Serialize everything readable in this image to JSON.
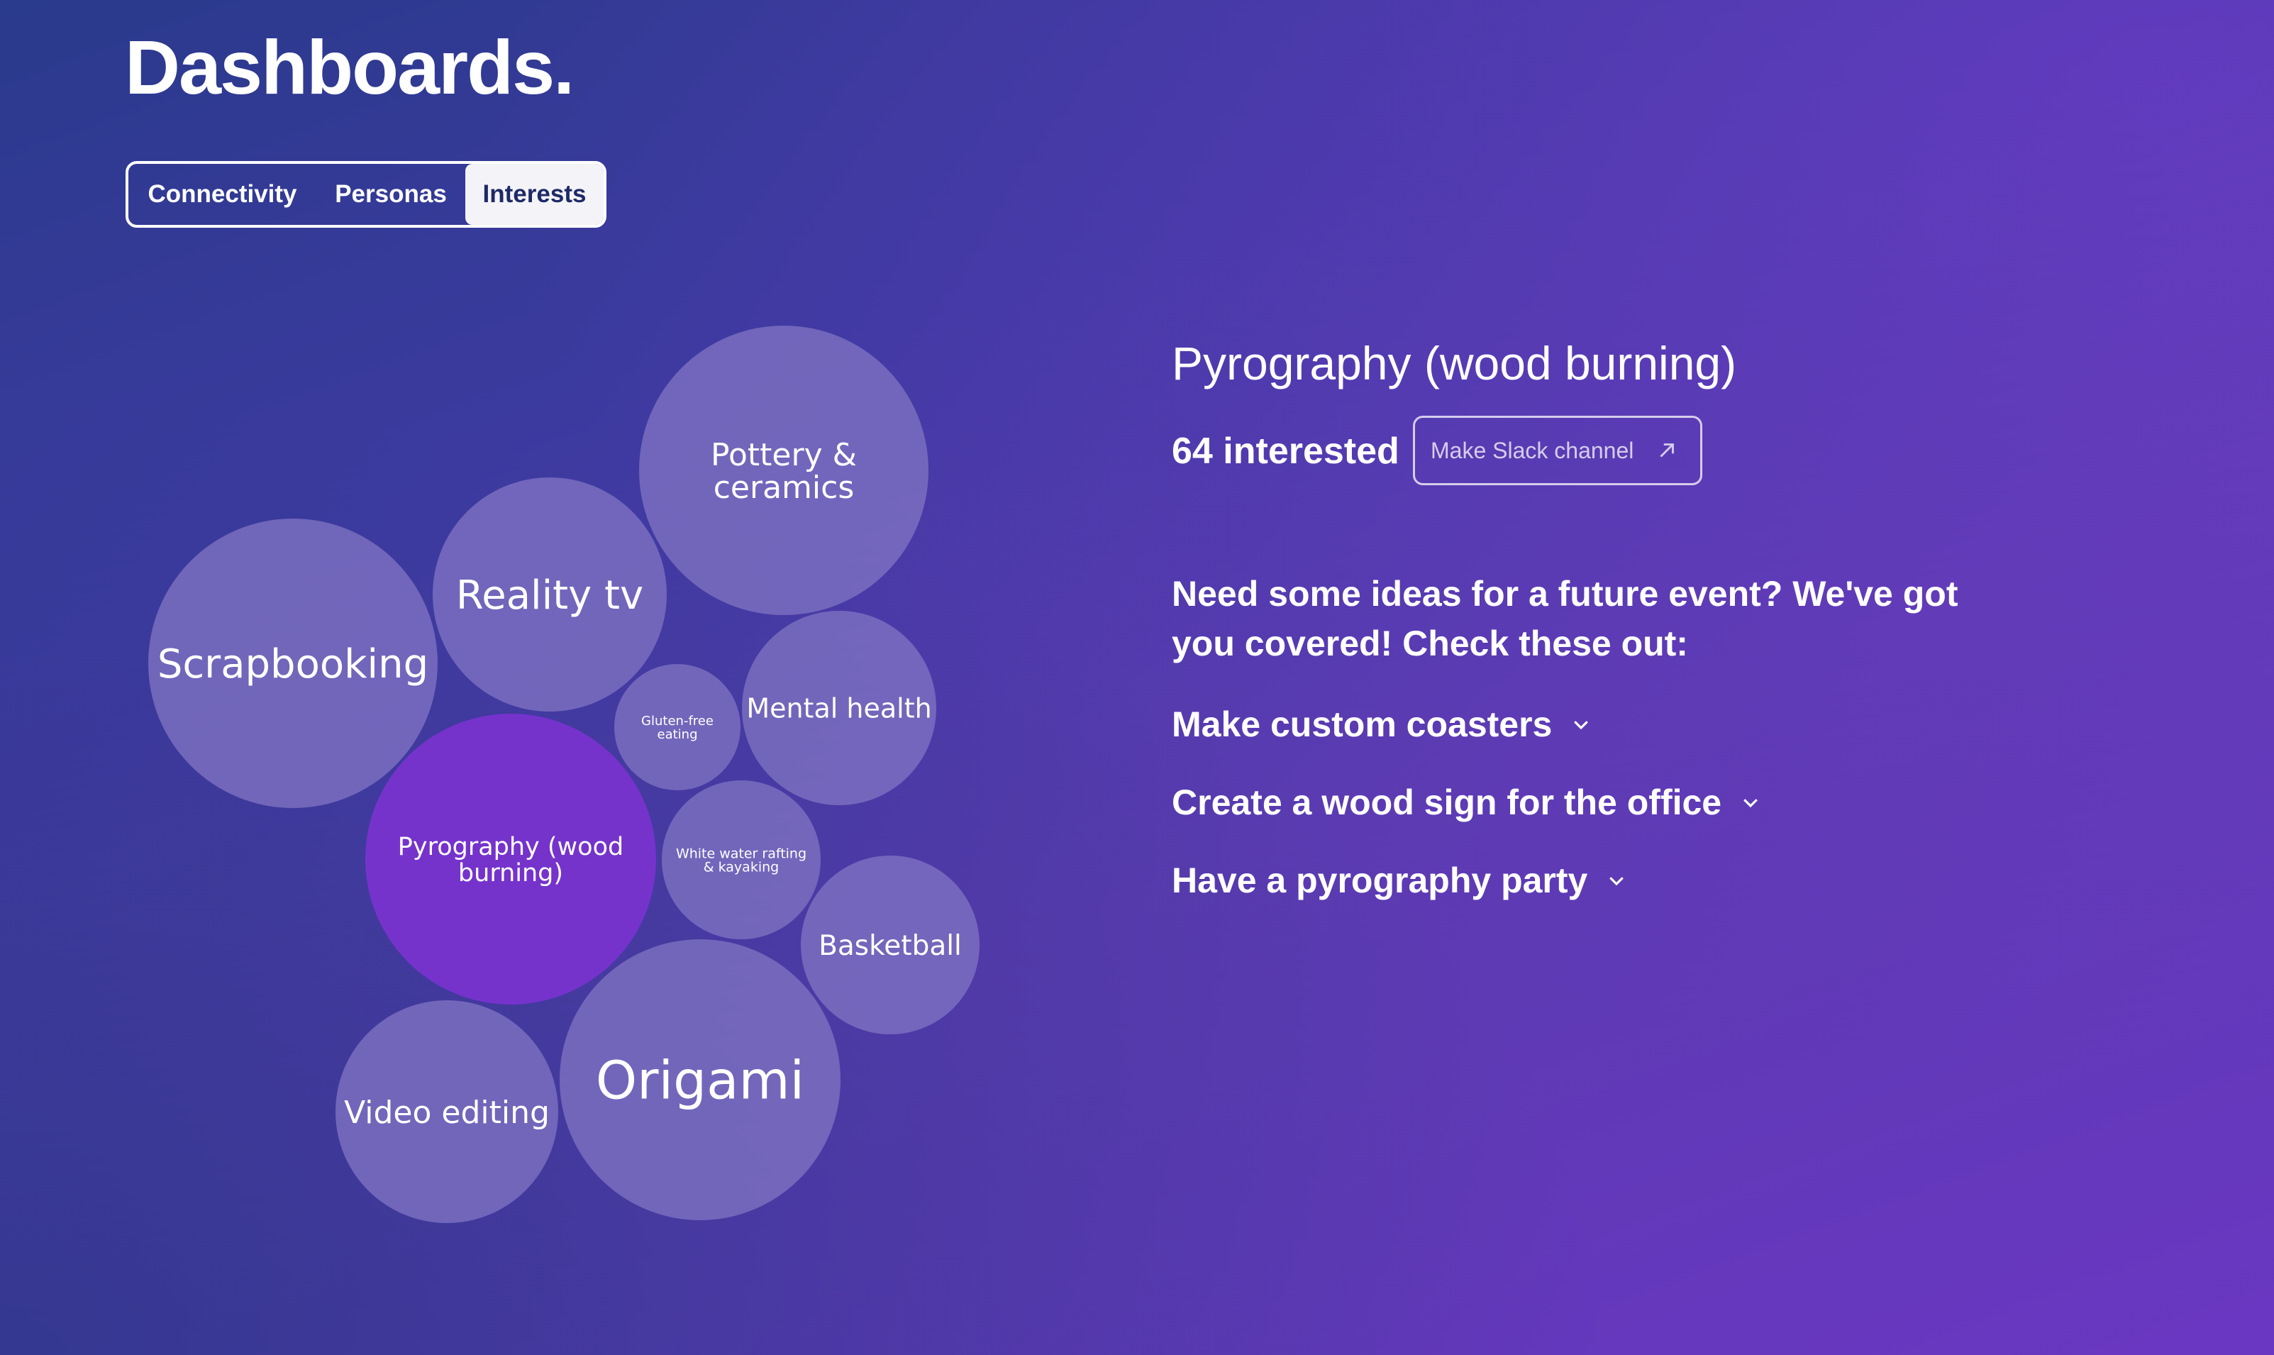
{
  "page": {
    "title": "Dashboards."
  },
  "tabs": [
    {
      "label": "Connectivity",
      "active": false
    },
    {
      "label": "Personas",
      "active": false
    },
    {
      "label": "Interests",
      "active": true
    }
  ],
  "colors": {
    "bubble": "#7a6fbf",
    "bubble_selected": "#7533cc",
    "active_tab_bg": "#f4f3f8",
    "active_tab_text": "#1e2a66"
  },
  "bubbles": [
    {
      "label_lines": [
        "Pottery &",
        "ceramics"
      ],
      "selected": false
    },
    {
      "label_lines": [
        "Reality tv"
      ],
      "selected": false
    },
    {
      "label_lines": [
        "Scrapbooking"
      ],
      "selected": false
    },
    {
      "label_lines": [
        "Gluten-free",
        "eating"
      ],
      "selected": false
    },
    {
      "label_lines": [
        "Mental health"
      ],
      "selected": false
    },
    {
      "label_lines": [
        "Pyrography (wood",
        "burning)"
      ],
      "selected": true
    },
    {
      "label_lines": [
        "White water rafting",
        "& kayaking"
      ],
      "selected": false
    },
    {
      "label_lines": [
        "Basketball"
      ],
      "selected": false
    },
    {
      "label_lines": [
        "Video editing"
      ],
      "selected": false
    },
    {
      "label_lines": [
        "Origami"
      ],
      "selected": false
    }
  ],
  "detail": {
    "title": "Pyrography (wood burning)",
    "interested": "64 interested",
    "slack_button": "Make Slack channel",
    "slack_icon": "arrow-up-right-icon",
    "ideas_intro": "Need some ideas for a future event? We've got you covered! Check these out:",
    "ideas": [
      {
        "label": "Make custom coasters",
        "icon": "chevron-down-icon"
      },
      {
        "label": "Create a wood sign for the office",
        "icon": "chevron-down-icon"
      },
      {
        "label": "Have a pyrography party",
        "icon": "chevron-down-icon"
      }
    ]
  }
}
